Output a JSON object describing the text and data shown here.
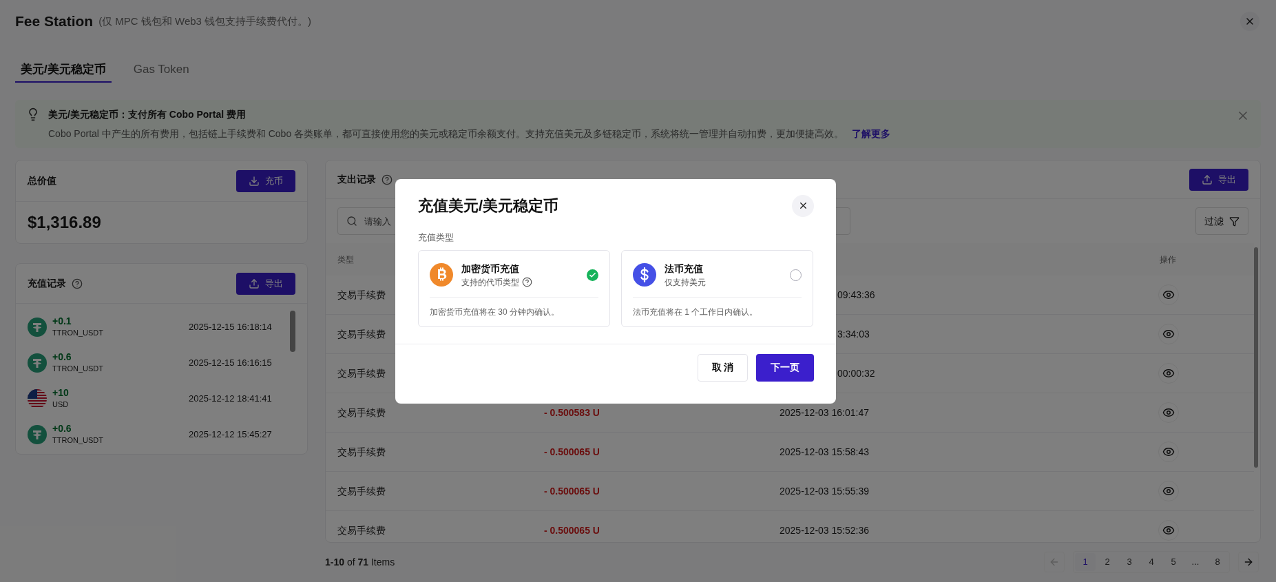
{
  "header": {
    "title": "Fee Station",
    "subtitle": "(仅 MPC 钱包和 Web3 钱包支持手续费代付。)"
  },
  "tabs": [
    {
      "label": "美元/美元稳定币",
      "selected": true
    },
    {
      "label": "Gas Token",
      "selected": false
    }
  ],
  "alert": {
    "title": "美元/美元稳定币：支付所有 Cobo Portal 费用",
    "body": "Cobo Portal 中产生的所有费用，包括链上手续费和 Cobo 各类账单，都可直接使用您的美元或稳定币余额支付。支持充值美元及多链稳定币，系统将统一管理并自动扣费，更加便捷高效。",
    "link": "了解更多"
  },
  "total": {
    "title": "总价值",
    "button": "充币",
    "value": "$1,316.89"
  },
  "deposits": {
    "title": "充值记录",
    "button": "导出",
    "rows": [
      {
        "kind": "tether",
        "amount": "+0.1",
        "asset": "TTRON_USDT",
        "time": "2025-12-15 16:18:14"
      },
      {
        "kind": "tether",
        "amount": "+0.6",
        "asset": "TTRON_USDT",
        "time": "2025-12-15 16:16:15"
      },
      {
        "kind": "flag",
        "amount": "+10",
        "asset": "USD",
        "time": "2025-12-12 18:41:41"
      },
      {
        "kind": "tether",
        "amount": "+0.6",
        "asset": "TTRON_USDT",
        "time": "2025-12-12 15:45:27"
      }
    ]
  },
  "expenses": {
    "title": "支出记录",
    "export": "导出",
    "search_placeholder": "请输入",
    "filter": "过滤",
    "columns": {
      "type": "类型",
      "action": "操作"
    },
    "rows": [
      {
        "type": "交易手续费",
        "time": "09:43:36"
      },
      {
        "type": "交易手续费",
        "time": "3:34:03"
      },
      {
        "type": "交易手续费",
        "time": "00:00:32"
      },
      {
        "type": "交易手续费",
        "amount": "- 0.500583 U",
        "time": "2025-12-03 16:01:47"
      },
      {
        "type": "交易手续费",
        "amount": "- 0.500065 U",
        "time": "2025-12-03 15:58:43"
      },
      {
        "type": "交易手续费",
        "amount": "- 0.500065 U",
        "time": "2025-12-03 15:55:39"
      },
      {
        "type": "交易手续费",
        "amount": "- 0.500065 U",
        "time": "2025-12-03 15:52:36"
      }
    ],
    "summary": "**1-10** of **71** Items",
    "pages": [
      {
        "label": "1",
        "selected": true
      },
      {
        "label": "2",
        "selected": false
      },
      {
        "label": "3",
        "selected": false
      },
      {
        "label": "4",
        "selected": false
      },
      {
        "label": "5",
        "selected": false
      },
      {
        "label": "...",
        "selected": false
      },
      {
        "label": "8",
        "selected": false
      }
    ]
  },
  "modal": {
    "title": "充值美元/美元稳定币",
    "section": "充值类型",
    "options": [
      {
        "kind": "crypto",
        "title": "加密货币充值",
        "subtitle": "支持的代币类型",
        "help": true,
        "note": "加密货币充值将在 30 分钟内确认。",
        "selected": true
      },
      {
        "kind": "fiat",
        "title": "法币充值",
        "subtitle": "仅支持美元",
        "help": false,
        "note": "法币充值将在 1 个工作日内确认。",
        "selected": false
      }
    ],
    "cancel": "取 消",
    "next": "下一页"
  }
}
